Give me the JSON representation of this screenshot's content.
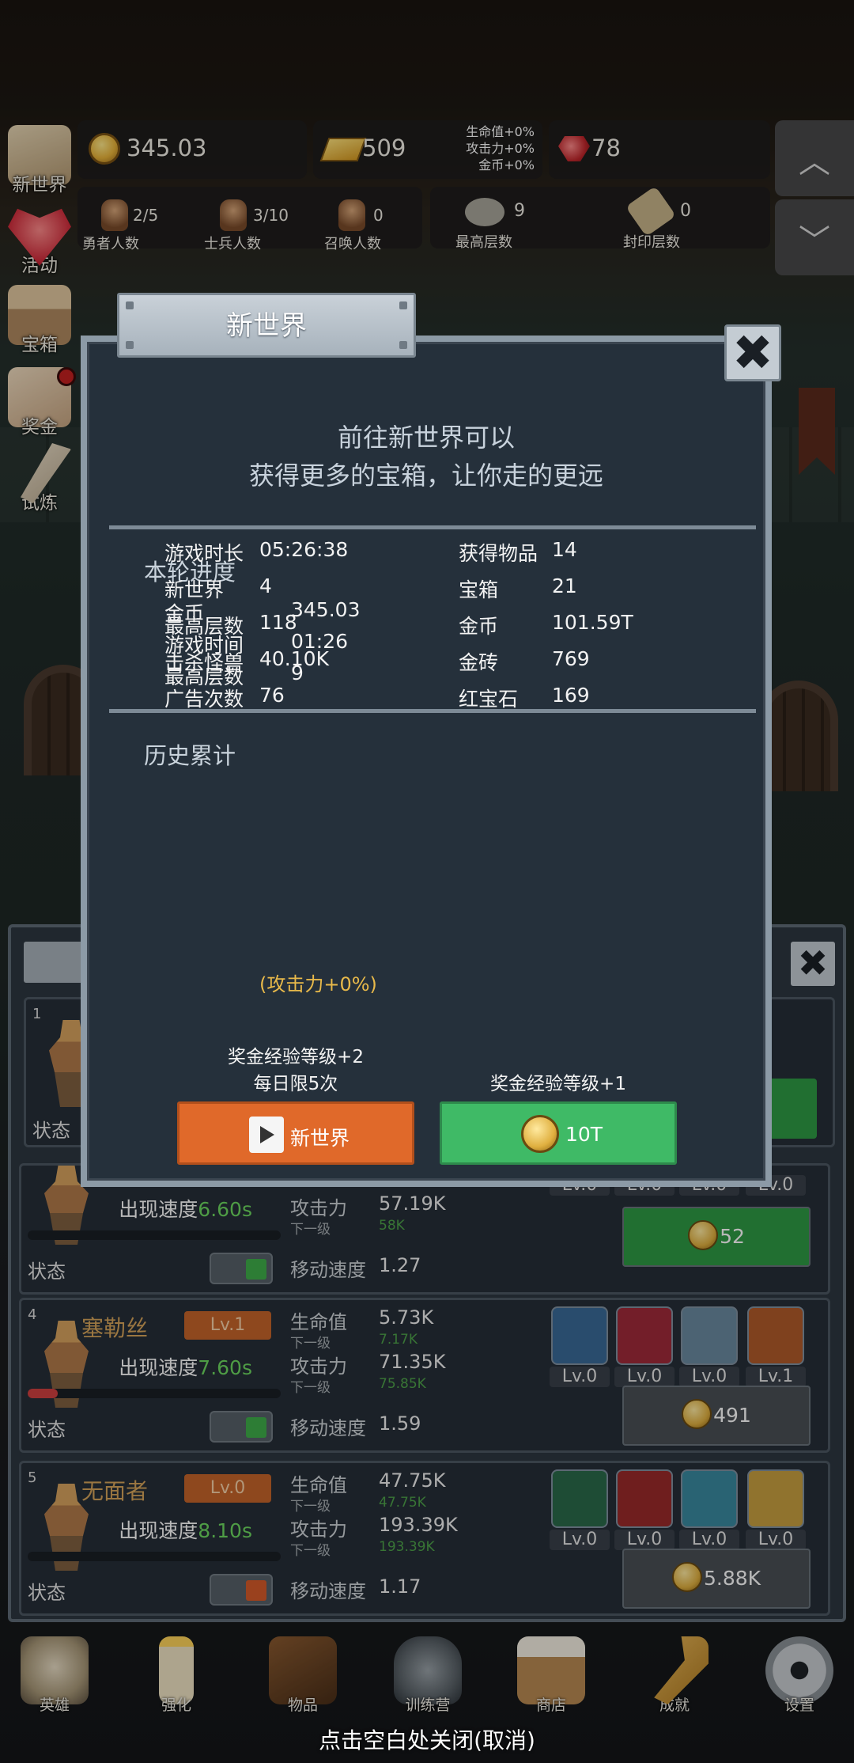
{
  "top_stats": {
    "gold": "345.03",
    "gold_bars": "509",
    "bonus_lines": [
      "生命值+0%",
      "攻击力+0%",
      "金币+0%"
    ],
    "rubies": "78"
  },
  "sub_stats": [
    {
      "value": "2/5",
      "label": "勇者人数"
    },
    {
      "value": "3/10",
      "label": "士兵人数"
    },
    {
      "value": "0",
      "label": "召唤人数"
    },
    {
      "value": "9",
      "label": "最高层数"
    },
    {
      "value": "0",
      "label": "封印层数"
    }
  ],
  "side_menu": [
    "新世界",
    "活动",
    "宝箱",
    "奖金",
    "试炼"
  ],
  "dialog": {
    "title": "新世界",
    "intro_line1": "前往新世界可以",
    "intro_line2": "获得更多的宝箱，让你走的更远",
    "round_title": "本轮进度",
    "round": [
      {
        "label": "金币",
        "value": "345.03"
      },
      {
        "label": "游戏时间",
        "value": "01:26"
      },
      {
        "label": "最高层数",
        "value": "9"
      }
    ],
    "history_title": "历史累计",
    "history_left": [
      {
        "label": "游戏时长",
        "value": "05:26:38"
      },
      {
        "label": "新世界",
        "value": "4"
      },
      {
        "label": "最高层数",
        "value": "118"
      },
      {
        "label": "击杀怪兽",
        "value": "40.10K"
      },
      {
        "label": "广告次数",
        "value": "76"
      }
    ],
    "atk_bonus": "(攻击力+0%)",
    "history_right": [
      {
        "label": "获得物品",
        "value": "14"
      },
      {
        "label": "宝箱",
        "value": "21"
      },
      {
        "label": "金币",
        "value": "101.59T"
      },
      {
        "label": "金砖",
        "value": "769"
      },
      {
        "label": "红宝石",
        "value": "169"
      }
    ],
    "left_note1": "奖金经验等级+2",
    "left_note2": "每日限5次",
    "right_note": "奖金经验等级+1",
    "btn_new_world": "新世界",
    "btn_ten": "10T"
  },
  "heroes": [
    {
      "num": "",
      "name": "",
      "level": "",
      "speed_label": "出现速度",
      "speed": "6.60s",
      "state": "状态",
      "toggle_color": "#3fae4a",
      "hp": "",
      "hp_next": "",
      "atk": "57.19K",
      "atk_next": "58K",
      "move": "1.27",
      "skill_levels": [
        "Lv.0",
        "Lv.0",
        "Lv.0",
        "Lv.0"
      ],
      "cost": "52",
      "cost_color": "#2f9a44",
      "bar": 0
    },
    {
      "num": "4",
      "name": "塞勒丝",
      "level": "Lv.1",
      "speed_label": "出现速度",
      "speed": "7.60s",
      "state": "状态",
      "toggle_color": "#3fae4a",
      "hp": "5.73K",
      "hp_next": "7.17K",
      "atk": "71.35K",
      "atk_next": "75.85K",
      "move": "1.59",
      "skill_levels": [
        "Lv.0",
        "Lv.0",
        "Lv.0",
        "Lv.1"
      ],
      "cost": "491",
      "cost_color": "#4a4f55",
      "bar": 0.12
    },
    {
      "num": "5",
      "name": "无面者",
      "level": "Lv.0",
      "speed_label": "出现速度",
      "speed": "8.10s",
      "state": "状态",
      "toggle_color": "#d65a2a",
      "hp": "47.75K",
      "hp_next": "47.75K",
      "atk": "193.39K",
      "atk_next": "193.39K",
      "move": "1.17",
      "skill_levels": [
        "Lv.0",
        "Lv.0",
        "Lv.0",
        "Lv.0"
      ],
      "cost": "5.88K",
      "cost_color": "#4a4f55",
      "bar": 0
    }
  ],
  "stat_labels": {
    "hp": "生命值",
    "atk": "攻击力",
    "next": "下一级",
    "move": "移动速度"
  },
  "nav": [
    "英雄",
    "强化",
    "物品",
    "训练营",
    "商店",
    "成就",
    "设置"
  ],
  "close_hint": "点击空白处关闭(取消)"
}
